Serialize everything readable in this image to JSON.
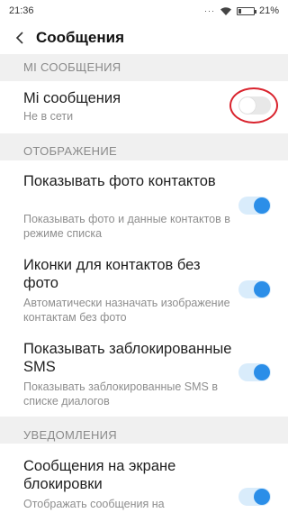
{
  "status_bar": {
    "time": "21:36",
    "dots": "···",
    "battery": "21%",
    "battery_level": 0.21
  },
  "header": {
    "title": "Сообщения"
  },
  "sections": {
    "mi": {
      "title": "MI СООБЩЕНИЯ"
    },
    "display": {
      "title": "ОТОБРАЖЕНИЕ"
    },
    "notifications": {
      "title": "УВЕДОМЛЕНИЯ"
    }
  },
  "settings": {
    "mi_messages": {
      "title": "Mi сообщения",
      "subtitle": "Не в сети",
      "enabled": false
    },
    "show_contact_photos": {
      "title": "Показывать фото контактов",
      "subtitle": "Показывать фото и данные контактов в режиме списка",
      "enabled": true
    },
    "icons_without_photo": {
      "title": "Иконки для контактов без фото",
      "subtitle": "Автоматически назначать изображение контактам без фото",
      "enabled": true
    },
    "show_blocked_sms": {
      "title": "Показывать заблокированные SMS",
      "subtitle": "Показывать заблокированные SMS в списке диалогов",
      "enabled": true
    },
    "lockscreen_messages": {
      "title": "Сообщения на экране блокировки",
      "subtitle": "Отображать сообщения на",
      "enabled": true
    }
  },
  "accent_color": "#2b8ee8",
  "highlight_color": "#d9232d"
}
